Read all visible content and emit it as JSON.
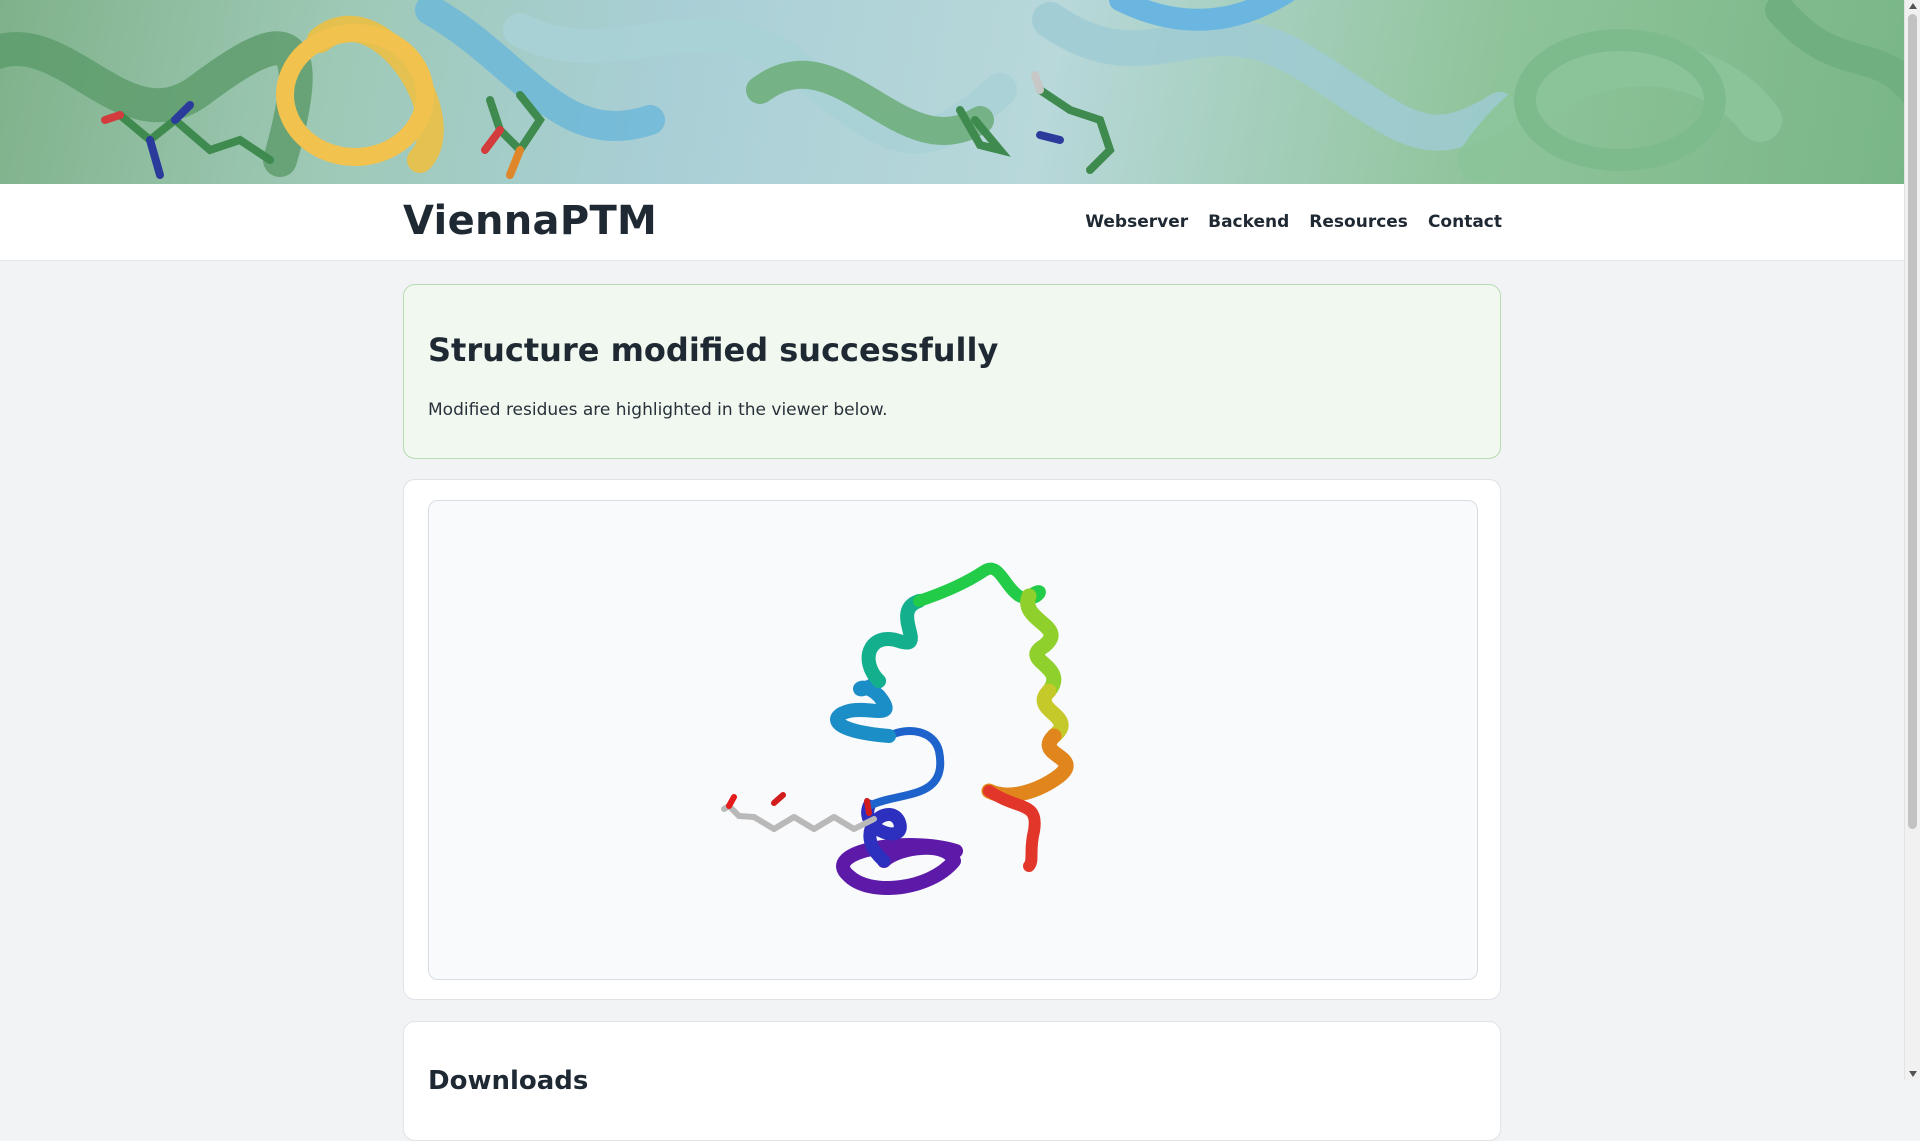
{
  "navbar": {
    "brand": "ViennaPTM",
    "links": [
      {
        "label": "Webserver"
      },
      {
        "label": "Backend"
      },
      {
        "label": "Resources"
      },
      {
        "label": "Contact"
      }
    ]
  },
  "alert": {
    "title": "Structure modified successfully",
    "message": "Modified residues are highlighted in the viewer below."
  },
  "viewer": {
    "content": "protein-ribbon-structure"
  },
  "downloads": {
    "title": "Downloads"
  },
  "colors": {
    "alert_background": "#f1f8ef",
    "alert_border": "#b7dbb2",
    "page_background": "#f1f3f5"
  }
}
